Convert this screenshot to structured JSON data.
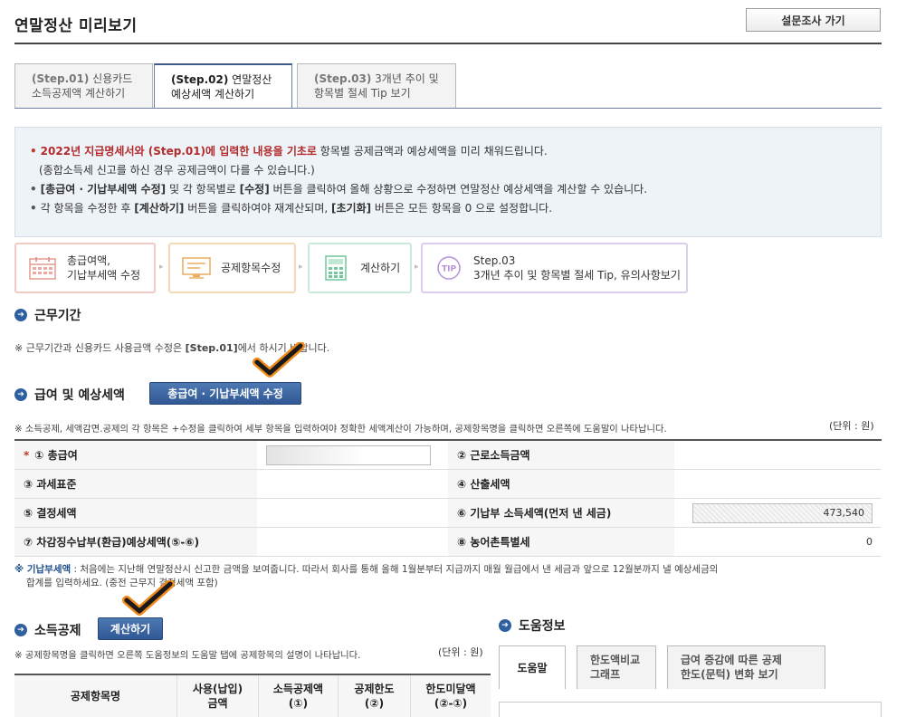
{
  "header": {
    "title": "연말정산 미리보기",
    "survey_label": "설문조사 가기"
  },
  "tabs": [
    {
      "step": "(Step.01)",
      "text1": " 신용카드",
      "text2": "소득공제액 계산하기"
    },
    {
      "step": "(Step.02)",
      "text1": " 연말정산",
      "text2": "예상세액 계산하기"
    },
    {
      "step": "(Step.03)",
      "text1": " 3개년 추이 및",
      "text2": "항목별 절세 Tip 보기"
    }
  ],
  "notice": {
    "line1_red": "2022년 지급명세서와 (Step.01)에 입력한 내용을 기초로",
    "line1_rest": " 항목별 공제금액과 예상세액을 미리 채워드립니다.",
    "line2": "(종합소득세 신고를 하신 경우 공제금액이 다를 수 있습니다.)",
    "line3_b1": "[총급여 · 기납부세액 수정]",
    "line3_m1": " 및 각 항목별로 ",
    "line3_b2": "[수정]",
    "line3_rest": " 버튼을 클릭하여 올해 상황으로 수정하면 연말정산 예상세액을 계산할 수 있습니다.",
    "line4_a": "각 항목을 수정한 후 ",
    "line4_b1": "[계산하기]",
    "line4_m": " 버튼을 클릭하여야 재계산되며, ",
    "line4_b2": "[초기화]",
    "line4_rest": " 버튼은 모든 항목을 0 으로 설정합니다."
  },
  "steps": [
    {
      "line1": "총급여액,",
      "line2": "기납부세액 수정",
      "color": "#e8a7a2",
      "icon": "calendar-icon"
    },
    {
      "line1": "공제항목수정",
      "line2": "",
      "color": "#f0c08a",
      "icon": "monitor-icon"
    },
    {
      "line1": "계산하기",
      "line2": "",
      "color": "#9ed8b8",
      "icon": "calculator-icon"
    },
    {
      "line1": "Step.03",
      "line2": "3개년 추이 및 항목별 절세 Tip, 유의사항보기",
      "color": "#c6aee0",
      "icon": "tip-icon"
    }
  ],
  "work_period": {
    "title": "근무기간",
    "note_a": "※ 근무기간과 신용카드 사용금액 수정은 ",
    "note_b": "[Step.01]",
    "note_c": "에서 하시기 바랍니다."
  },
  "salary": {
    "title": "급여 및 예상세액",
    "edit_label": "총급여 · 기납부세액 수정",
    "note": "※ 소득공제, 세액감면.공제의 각 항목은 +수정을 클릭하여 세부 항목을 입력하여야 정확한 세액계산이 가능하며, 공제항목명을 클릭하면 오른쪽에 도움말이 나타납니다.",
    "unit": "(단위 : 원)",
    "rows": [
      {
        "l1": "① 총급여",
        "v1": "",
        "l2": "② 근로소득금액",
        "v2": ""
      },
      {
        "l1": "③ 과세표준",
        "v1": "",
        "l2": "④ 산출세액",
        "v2": ""
      },
      {
        "l1": "⑤ 결정세액",
        "v1": "",
        "l2": "⑥ 기납부 소득세액(먼저 낸 세금)",
        "v2": "473,540"
      },
      {
        "l1": "⑦ 차감징수납부(환급)예상세액(⑤-⑥)",
        "v1": "",
        "l2": "⑧ 농어촌특별세",
        "v2": "0"
      }
    ],
    "star": "*",
    "footnote_b": "※ 기납부세액",
    "footnote_a": " : 처음에는 지난해 연말정산시 신고한 금액을 보여줍니다. 따라서 회사를 통해 올해 1월분부터 지급까지 매월 월급에서 낸 세금과 앞으로 12월분까지 낼 예상세금의",
    "footnote_c": "합계를 입력하세요. (중전 근무지 결정세액 포함)"
  },
  "deduction": {
    "title": "소득공제",
    "calc_label": "계산하기",
    "note": "※ 공제항목명을 클릭하면 오른쪽 도움정보의 도움말 탭에 공제항목의 설명이 나타납니다.",
    "unit": "(단위 : 원)",
    "headers": [
      {
        "l1": "공제항목명",
        "l2": ""
      },
      {
        "l1": "사용(납입)",
        "l2": "금액"
      },
      {
        "l1": "소득공제액",
        "l2": "(①)"
      },
      {
        "l1": "공제한도",
        "l2": "(②)"
      },
      {
        "l1": "한도미달액",
        "l2": "(②-①)"
      }
    ]
  },
  "help": {
    "title": "도움정보",
    "tabs": [
      {
        "l1": "도움말",
        "l2": ""
      },
      {
        "l1": "한도액비교",
        "l2": "그래프"
      },
      {
        "l1": "급여 증감에 따른 공제",
        "l2": "한도(문턱) 변화 보기"
      }
    ]
  }
}
